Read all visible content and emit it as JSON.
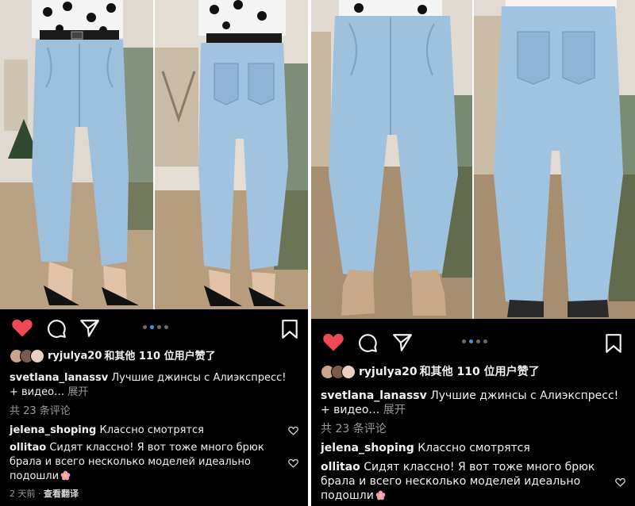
{
  "posts": [
    {
      "liked_by": "ryjulya20",
      "likes_suffix": "和其他 110 位用户赞了",
      "caption_user": "svetlana_lanassv",
      "caption_text": "Лучшие джинсы с Алиэкспресс!",
      "caption_more": "+ видео…",
      "expand_label": "展开",
      "comments_count": "共 23 条评论",
      "comments": [
        {
          "user": "jelena_shoping",
          "text": "Классно смотрятся"
        },
        {
          "user": "ollitao",
          "text_line1": "Сидят классно! Я вот тоже много брюк",
          "text_line2": "брала и всего несколько моделей идеально",
          "text_line3": "подошли"
        }
      ],
      "time": "2 天前",
      "translate": "查看翻译"
    },
    {
      "liked_by": "ryjulya20",
      "likes_suffix": "和其他 110 位用户赞了",
      "caption_user": "svetlana_lanassv",
      "caption_text": "Лучшие джинсы с Алиэкспресс!",
      "caption_more": "+ видео…",
      "expand_label": "展开",
      "comments_count": "共 23 条评论",
      "comments": [
        {
          "user": "jelena_shoping",
          "text": "Классно смотрятся"
        },
        {
          "user": "ollitao",
          "text_line1": "Сидят классно! Я вот тоже много брюк",
          "text_line2": "брала и всего несколько моделей идеально",
          "text_line3": "подошли"
        }
      ]
    }
  ],
  "icons": {
    "like": "heart-icon",
    "comment": "comment-icon",
    "share": "send-icon",
    "save": "bookmark-icon",
    "comment_like": "small-heart-icon",
    "emoji": "flower-emoji"
  },
  "colors": {
    "like_red": "#ed4956",
    "dot_active": "#3897f0",
    "background": "#000000",
    "text": "#f1f1f1",
    "muted": "#9a9a9a"
  }
}
